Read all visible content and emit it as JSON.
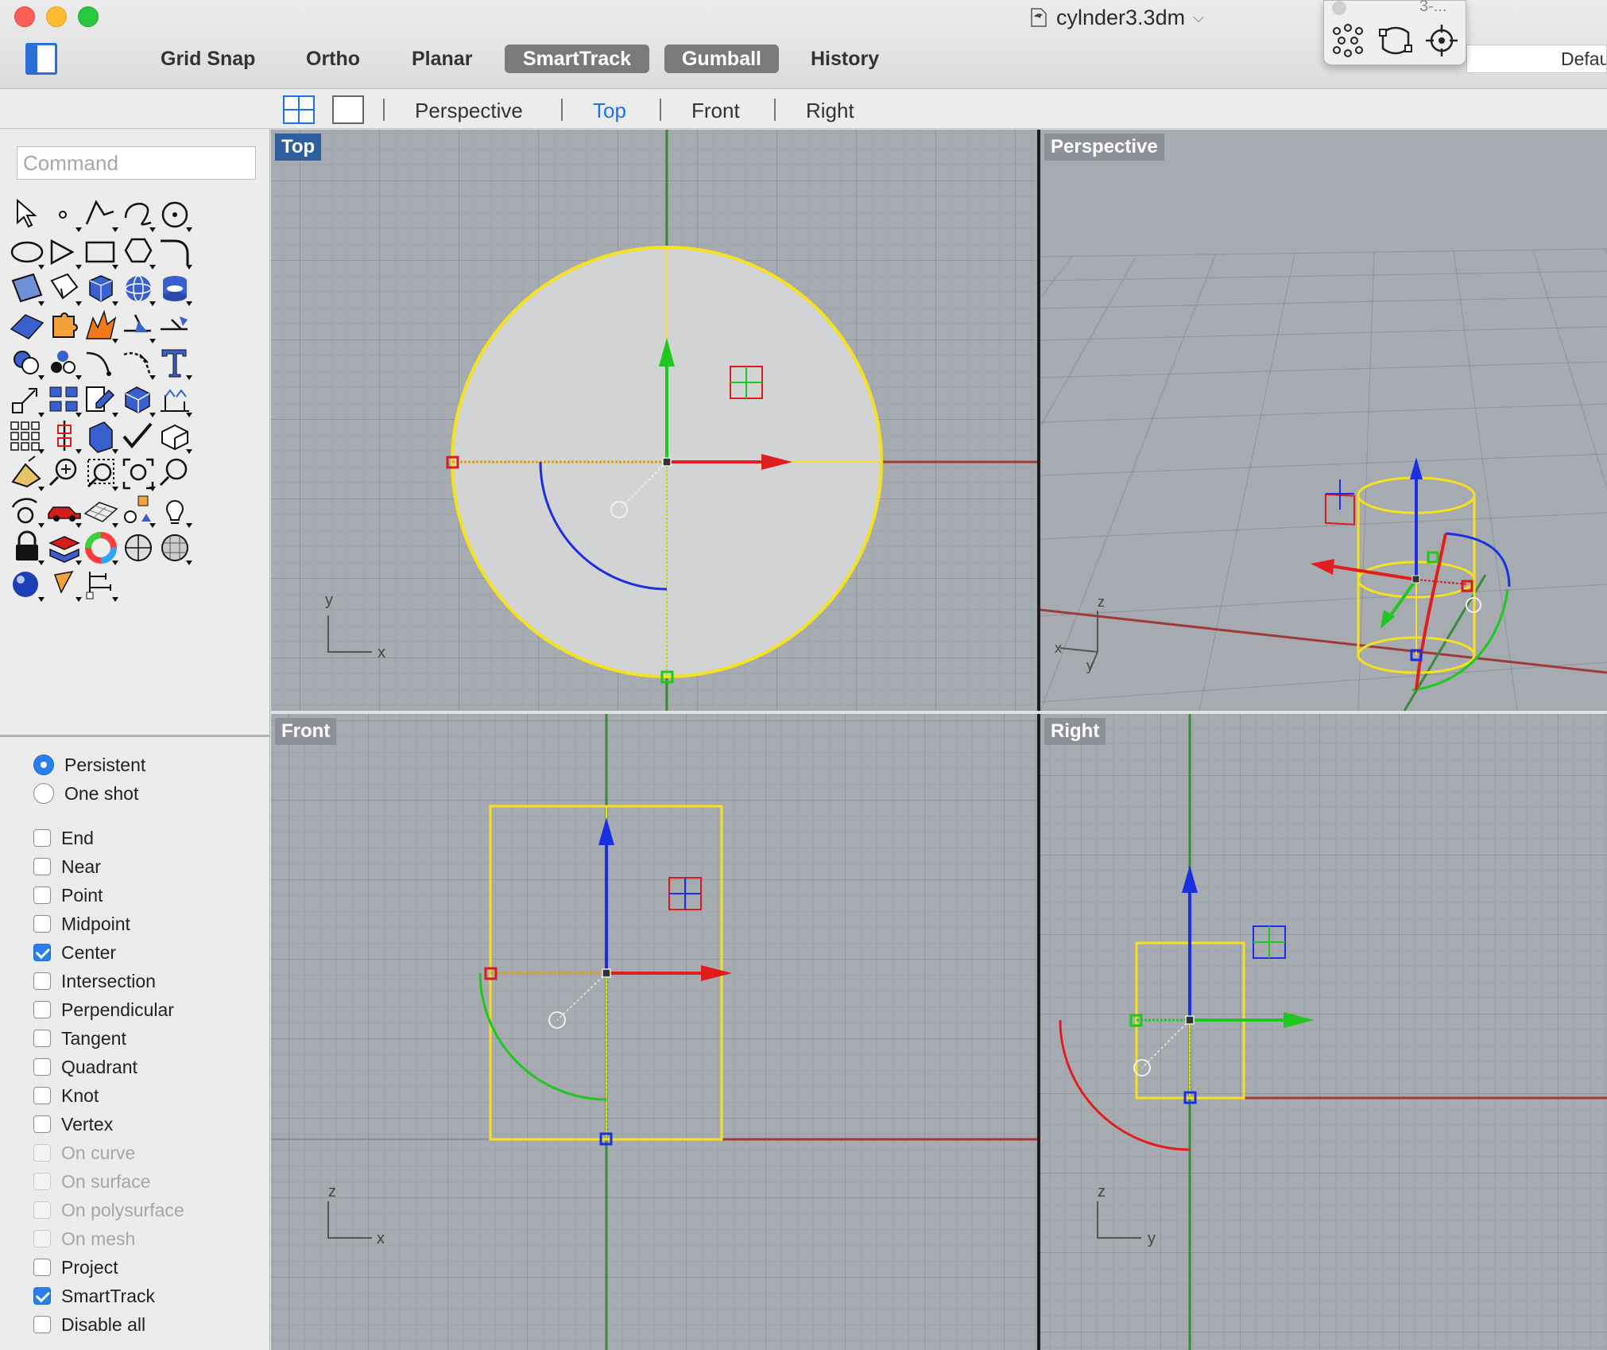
{
  "window": {
    "title": "cylnder3.3dm",
    "mode_buttons": {
      "grid_snap": "Grid Snap",
      "ortho": "Ortho",
      "planar": "Planar",
      "smarttrack": "SmartTrack",
      "gumball": "Gumball",
      "history": "History"
    },
    "palette_title": "3-...",
    "layer_value": "Defau"
  },
  "viewport_tabs": [
    "Perspective",
    "Top",
    "Front",
    "Right"
  ],
  "active_tab": "Top",
  "command": {
    "placeholder": "Command"
  },
  "osnap": {
    "modes": [
      {
        "label": "Persistent",
        "checked": true
      },
      {
        "label": "One shot",
        "checked": false
      }
    ],
    "items": [
      {
        "label": "End",
        "checked": false,
        "enabled": true
      },
      {
        "label": "Near",
        "checked": false,
        "enabled": true
      },
      {
        "label": "Point",
        "checked": false,
        "enabled": true
      },
      {
        "label": "Midpoint",
        "checked": false,
        "enabled": true
      },
      {
        "label": "Center",
        "checked": true,
        "enabled": true
      },
      {
        "label": "Intersection",
        "checked": false,
        "enabled": true
      },
      {
        "label": "Perpendicular",
        "checked": false,
        "enabled": true
      },
      {
        "label": "Tangent",
        "checked": false,
        "enabled": true
      },
      {
        "label": "Quadrant",
        "checked": false,
        "enabled": true
      },
      {
        "label": "Knot",
        "checked": false,
        "enabled": true
      },
      {
        "label": "Vertex",
        "checked": false,
        "enabled": true
      },
      {
        "label": "On curve",
        "checked": false,
        "enabled": false
      },
      {
        "label": "On surface",
        "checked": false,
        "enabled": false
      },
      {
        "label": "On polysurface",
        "checked": false,
        "enabled": false
      },
      {
        "label": "On mesh",
        "checked": false,
        "enabled": false
      },
      {
        "label": "Project",
        "checked": false,
        "enabled": true
      },
      {
        "label": "SmartTrack",
        "checked": true,
        "enabled": true
      },
      {
        "label": "Disable all",
        "checked": false,
        "enabled": true
      }
    ]
  },
  "viewports": {
    "top": {
      "label": "Top",
      "axis_a": "y",
      "axis_b": "x"
    },
    "perspective": {
      "label": "Perspective",
      "axis_a": "z",
      "axis_b": "x",
      "axis_c": "y"
    },
    "front": {
      "label": "Front",
      "axis_a": "z",
      "axis_b": "x"
    },
    "right": {
      "label": "Right",
      "axis_a": "z",
      "axis_b": "y"
    }
  },
  "colors": {
    "accent": "#1a73e8",
    "viewport_bg": "#a6aab1",
    "selection": "#f5e11d",
    "gumball_x": "#e11d1d",
    "gumball_y": "#1ec81e",
    "gumball_z": "#1c2fe0"
  },
  "tools": [
    "select-arrow-icon",
    "point-icon",
    "polyline-icon",
    "curve-icon",
    "circle-icon",
    "ellipse-icon",
    "arc-icon",
    "rectangle-icon",
    "polygon-icon",
    "fillet-icon",
    "surface-corners-icon",
    "extrude-surface-icon",
    "box-icon",
    "sphere-icon",
    "cylinder-icon",
    "planar-surface-icon",
    "puzzle-icon",
    "explode-icon",
    "trim-icon",
    "split-icon",
    "boolean-union-icon",
    "group-icon",
    "curve-offset-icon",
    "blend-icon",
    "text-icon",
    "scale-icon",
    "array-icon",
    "edit-icon",
    "solid-edit-icon",
    "dimension-icon",
    "grid-array-icon",
    "align-icon",
    "properties-icon",
    "check-icon",
    "cube-analyze-icon",
    "paint-icon",
    "zoom-window-icon",
    "zoom-selected-icon",
    "zoom-extents-icon",
    "zoom-icon",
    "rotate-view-icon",
    "car-icon",
    "plane-grid-icon",
    "shapes-icon",
    "light-bulb-icon",
    "lock-icon",
    "layers-icon",
    "color-wheel-icon",
    "sphere-wire-icon",
    "mesh-sphere-icon",
    "render-sphere-icon",
    "camera-icon",
    "dimension-tree-icon"
  ]
}
